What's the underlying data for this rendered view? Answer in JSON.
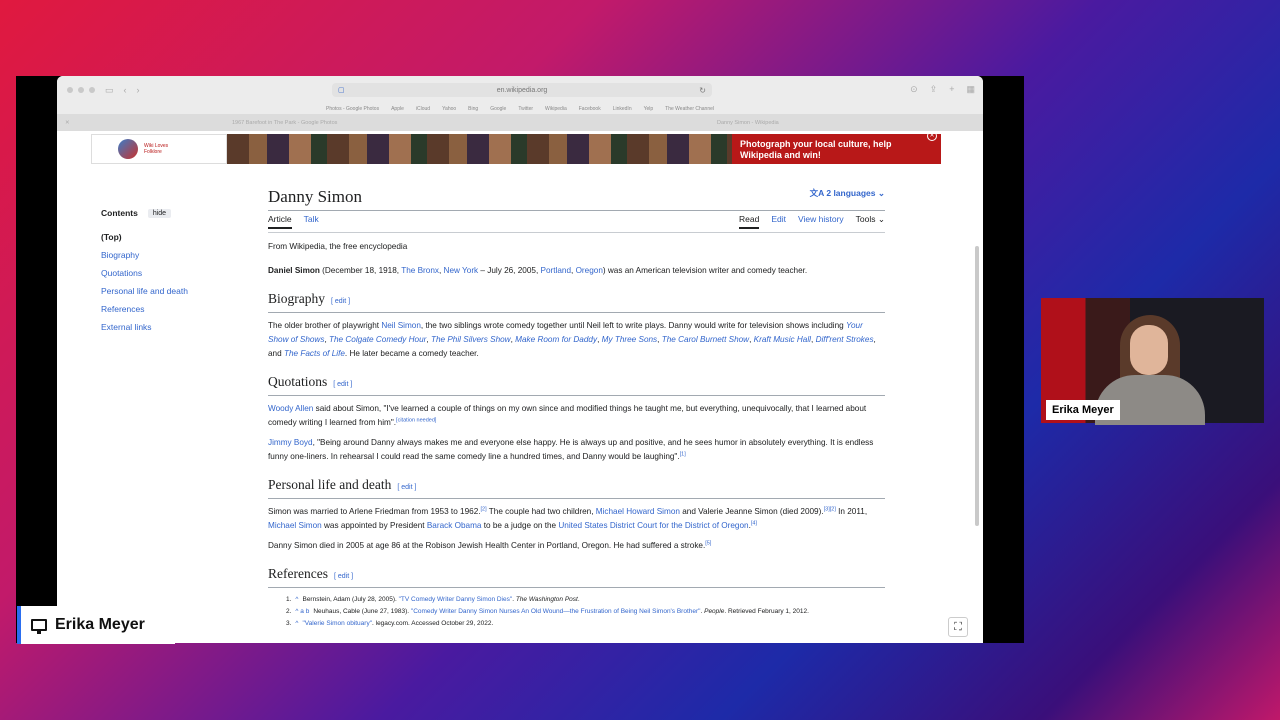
{
  "browser": {
    "url": "en.wikipedia.org",
    "favorites": [
      "Photos - Google Photos",
      "Apple",
      "iCloud",
      "Yahoo",
      "Bing",
      "Google",
      "Twitter",
      "Wikipedia",
      "Facebook",
      "LinkedIn",
      "Yelp",
      "The Weather Channel"
    ],
    "tabs": [
      "1967 Barefoot in The Park - Google Photos",
      "Danny Simon - Wikipedia"
    ]
  },
  "banner": {
    "logo_text": [
      "Wiki Loves",
      "Folklore"
    ],
    "message": "Photograph your local culture, help Wikipedia and win!"
  },
  "toc": {
    "heading": "Contents",
    "hide_label": "hide",
    "items": [
      "(Top)",
      "Biography",
      "Quotations",
      "Personal life and death",
      "References",
      "External links"
    ]
  },
  "article": {
    "title": "Danny Simon",
    "languages": "2 languages",
    "tabs_left": [
      "Article",
      "Talk"
    ],
    "tabs_right": [
      "Read",
      "Edit",
      "View history",
      "Tools"
    ],
    "from": "From Wikipedia, the free encyclopedia",
    "edit_label": "edit",
    "lead": {
      "name": "Daniel Simon",
      "t1": " (December 18, 1918, ",
      "l1": "The Bronx",
      "t2": ", ",
      "l2": "New York",
      "t3": " – July 26, 2005, ",
      "l3": "Portland",
      "t4": ", ",
      "l4": "Oregon",
      "t5": ") was an American television writer and comedy teacher."
    },
    "biography": {
      "heading": "Biography",
      "t1": "The older brother of playwright ",
      "l1": "Neil Simon",
      "t2": ", the two siblings wrote comedy together until Neil left to write plays. Danny would write for television shows including ",
      "shows": [
        "Your Show of Shows",
        "The Colgate Comedy Hour",
        "The Phil Silvers Show",
        "Make Room for Daddy",
        "My Three Sons",
        "The Carol Burnett Show",
        "Kraft Music Hall",
        "Diff'rent Strokes"
      ],
      "and": ", and ",
      "last_show": "The Facts of Life",
      "t3": ". He later became a comedy teacher."
    },
    "quotations": {
      "heading": "Quotations",
      "q1_link": "Woody Allen",
      "q1_text": " said about Simon, \"I've learned a couple of things on my own since and modified things he taught me, but everything, unequivocally, that I learned about comedy writing I learned from him\".",
      "q1_sup": "[citation needed]",
      "q2_link": "Jimmy Boyd",
      "q2_text": ", \"Being around Danny always makes me and everyone else happy. He is always up and positive, and he sees humor in absolutely everything. It is endless funny one-liners. In rehearsal I could read the same comedy line a hundred times, and Danny would be laughing\".",
      "q2_sup": "[1]"
    },
    "personal": {
      "heading": "Personal life and death",
      "t1": "Simon was married to Arlene Friedman from 1953 to 1962.",
      "s1": "[2]",
      "t2": " The couple had two children, ",
      "l1": "Michael Howard Simon",
      "t3": " and Valerie Jeanne Simon (died 2009).",
      "s2": "[3][2]",
      "t4": " In 2011, ",
      "l2": "Michael Simon",
      "t5": " was appointed by President ",
      "l3": "Barack Obama",
      "t6": " to be a judge on the ",
      "l4": "United States District Court for the District of Oregon",
      "t7": ".",
      "s3": "[4]",
      "p2": "Danny Simon died in 2005 at age 86 at the Robison Jewish Health Center in Portland, Oregon. He had suffered a stroke.",
      "s4": "[5]"
    },
    "references": {
      "heading": "References",
      "r1_num": "1.",
      "r1_caret": "^",
      "r1_a": "Bernstein, Adam (July 28, 2005). ",
      "r1_link": "\"TV Comedy Writer Danny Simon Dies\"",
      "r1_b": ". ",
      "r1_pub": "The Washington Post",
      "r1_c": ".",
      "r2_num": "2.",
      "r2_caret": "^ a b",
      "r2_a": "Neuhaus, Cable (June 27, 1983). ",
      "r2_link": "\"Comedy Writer Danny Simon Nurses An Old Wound—the Frustration of Being Neil Simon's Brother\"",
      "r2_b": ". ",
      "r2_pub": "People",
      "r2_c": ". Retrieved February 1, 2012.",
      "r3_num": "3.",
      "r3_caret": "^",
      "r3_link": "\"Valerie Simon obituary\"",
      "r3_a": ". legacy.com. Accessed October 29, 2022."
    }
  },
  "participant": {
    "name": "Erika Meyer"
  },
  "presenter": {
    "name": "Erika Meyer"
  }
}
